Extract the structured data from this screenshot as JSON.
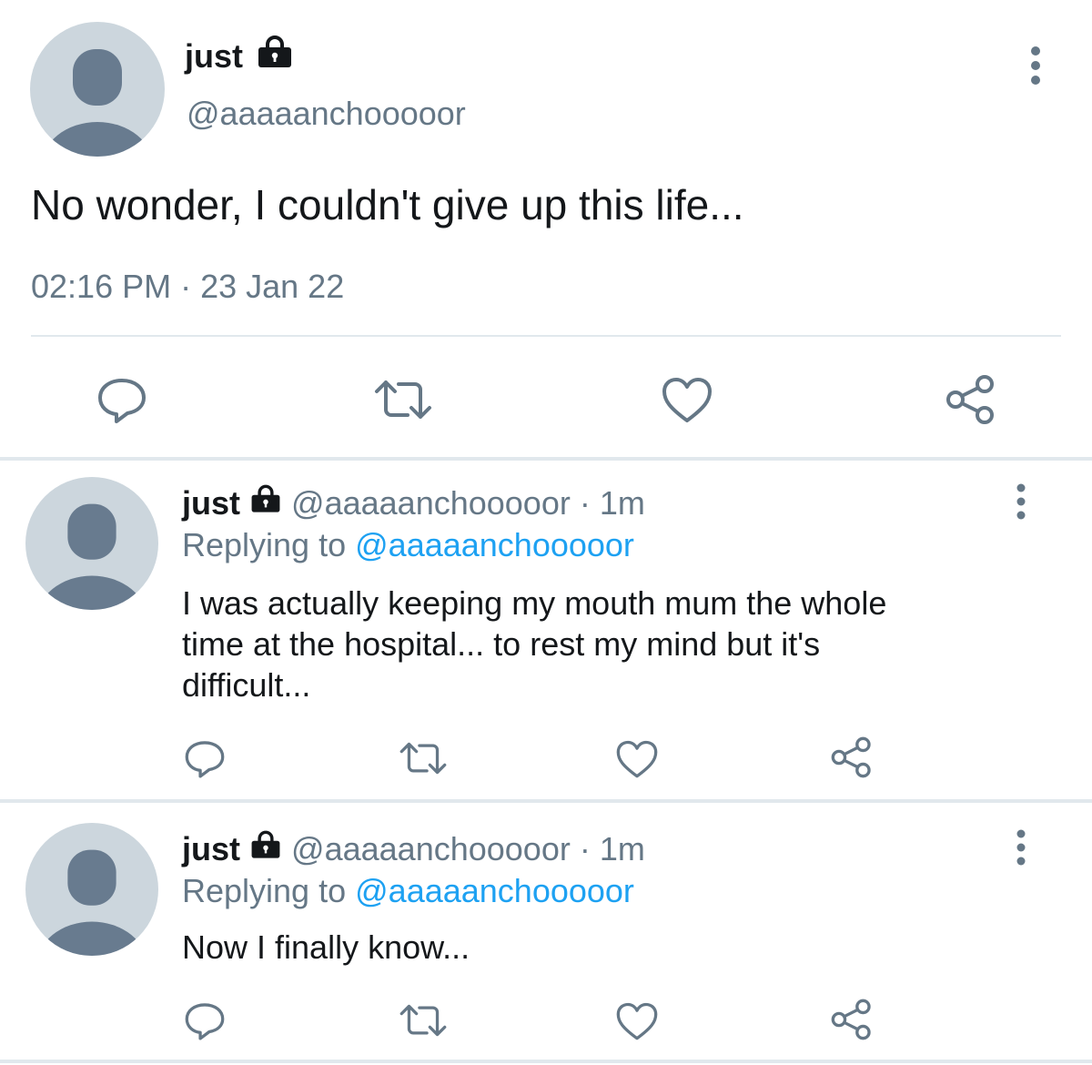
{
  "main_tweet": {
    "display_name": "just",
    "handle": "@aaaaanchooooor",
    "text": "No wonder, I couldn't give up this life...",
    "timestamp": "02:16 PM · 23 Jan 22",
    "actions": [
      "reply-icon",
      "retweet-icon",
      "like-icon",
      "share-icon"
    ]
  },
  "replies": [
    {
      "display_name": "just",
      "handle": "@aaaaanchooooor",
      "time": "· 1m",
      "replying_label": "Replying to",
      "replying_to": "@aaaaanchooooor",
      "text_lines": [
        "I was actually keeping my mouth mum the whole",
        "time at the hospital... to rest my mind but it's",
        "difficult..."
      ]
    },
    {
      "display_name": "just",
      "handle": "@aaaaanchooooor",
      "time": "· 1m",
      "replying_label": "Replying to",
      "replying_to": "@aaaaanchooooor",
      "text_lines": [
        "Now I finally know..."
      ]
    }
  ],
  "colors": {
    "text": "#14171a",
    "muted": "#657786",
    "link": "#1da1f2",
    "avatar_bg": "#ccd6dd",
    "avatar_fg": "#687b8f",
    "divider": "#e1e8ed"
  }
}
